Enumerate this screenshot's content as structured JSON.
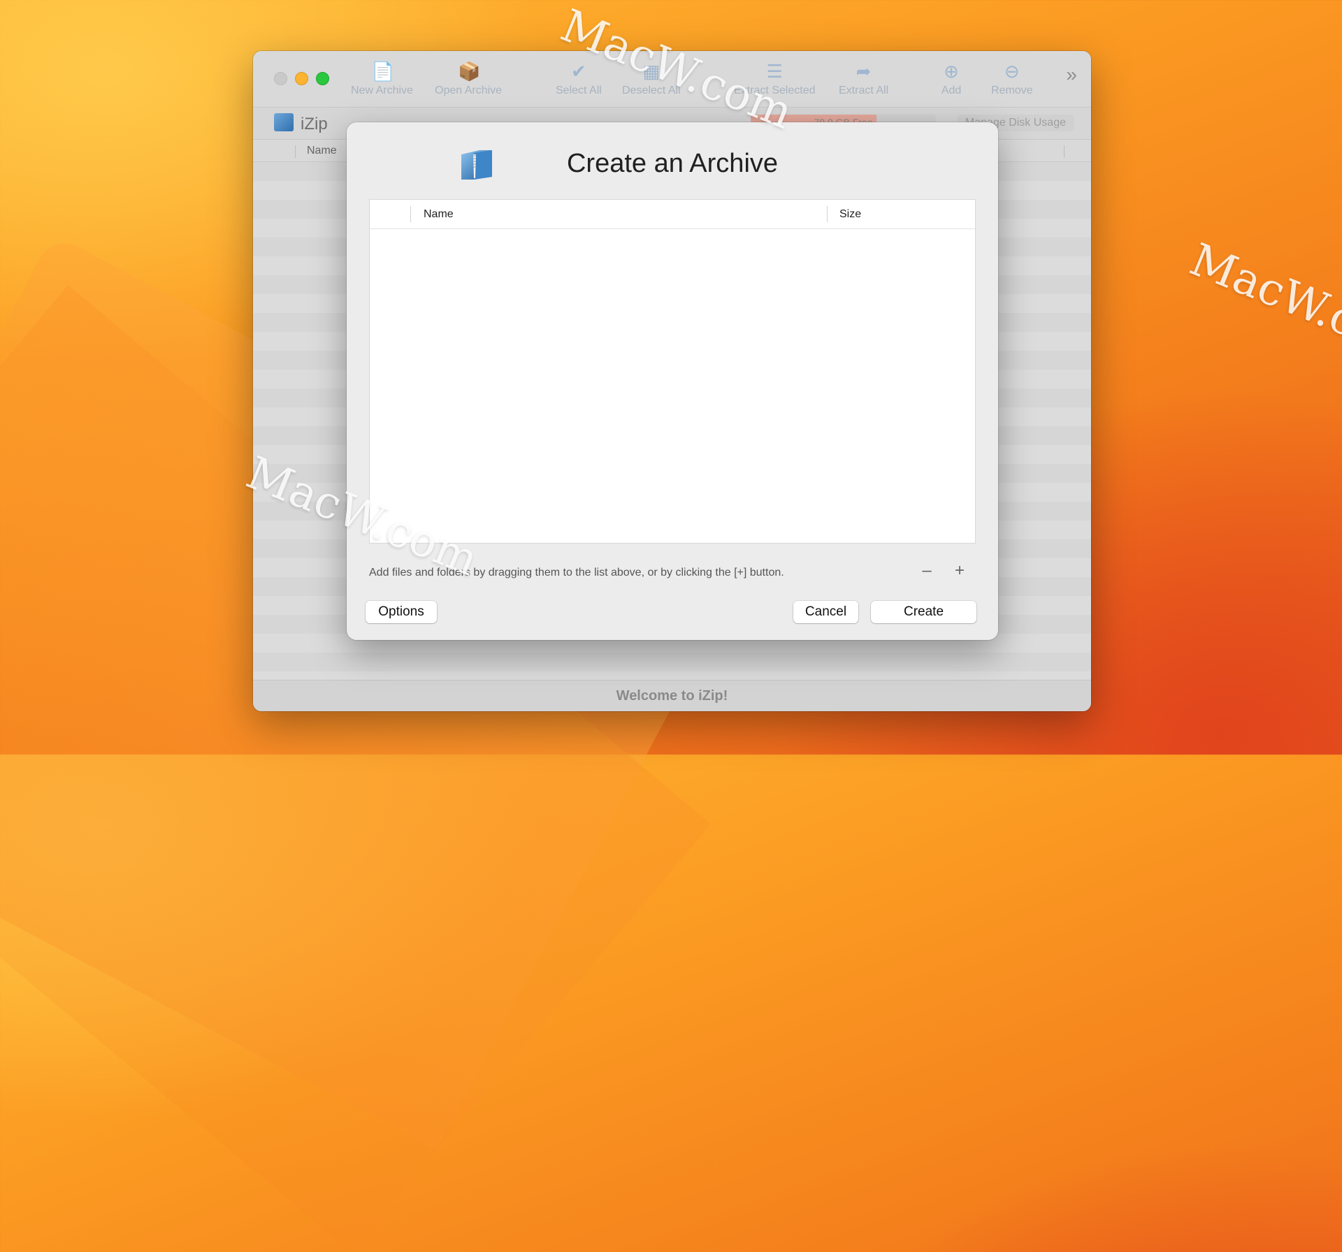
{
  "window": {
    "toolbar": [
      {
        "label": "New Archive",
        "icon": "new-archive-icon"
      },
      {
        "label": "Open Archive",
        "icon": "open-archive-icon"
      },
      {
        "label": "Select All",
        "icon": "select-all-icon"
      },
      {
        "label": "Deselect All",
        "icon": "deselect-all-icon"
      },
      {
        "label": "Extract Selected",
        "icon": "extract-selected-icon"
      },
      {
        "label": "Extract All",
        "icon": "extract-all-icon"
      },
      {
        "label": "Add",
        "icon": "add-icon"
      },
      {
        "label": "Remove",
        "icon": "remove-icon"
      }
    ],
    "app_name": "iZip",
    "disk_free": "70.0 GB Free",
    "manage_disk_usage": "Manage Disk Usage",
    "column_name": "Name",
    "status": "Welcome to iZip!"
  },
  "dialog": {
    "title": "Create an Archive",
    "columns": {
      "name": "Name",
      "size": "Size"
    },
    "hint": "Add files and folders by dragging them to the list above, or by clicking the [+] button.",
    "minus": "–",
    "plus": "+",
    "options_label": "Options",
    "cancel_label": "Cancel",
    "create_label": "Create"
  },
  "watermark": "MacW.com",
  "colors": {
    "accent": "#2f6fae",
    "close": "#c9c9c9",
    "minimize": "#fbb331",
    "maximize": "#2ac740"
  }
}
